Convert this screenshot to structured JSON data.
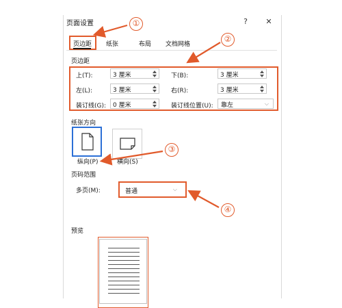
{
  "dialog": {
    "title": "页面设置",
    "help": "?",
    "close": "✕"
  },
  "tabs": [
    {
      "label": "页边距"
    },
    {
      "label": "纸张"
    },
    {
      "label": "布局"
    },
    {
      "label": "文档网格"
    }
  ],
  "margins": {
    "section_title": "页边距",
    "top": {
      "label": "上(T):",
      "value": "3 厘米"
    },
    "bottom": {
      "label": "下(B):",
      "value": "3 厘米"
    },
    "left": {
      "label": "左(L):",
      "value": "3 厘米"
    },
    "right": {
      "label": "右(R):",
      "value": "3 厘米"
    },
    "gutter": {
      "label": "装订线(G):",
      "value": "0 厘米"
    },
    "gutter_pos": {
      "label": "装订线位置(U):",
      "value": "靠左"
    }
  },
  "orientation": {
    "section_title": "纸张方向",
    "portrait": "纵向(P)",
    "landscape": "横向(S)"
  },
  "pages": {
    "section_title": "页码范围",
    "multi_label": "多页(M):",
    "multi_value": "普通"
  },
  "preview": {
    "section_title": "预览"
  },
  "annotations": {
    "n1": "①",
    "n2": "②",
    "n3": "③",
    "n4": "④",
    "color": "#e15a2b"
  }
}
